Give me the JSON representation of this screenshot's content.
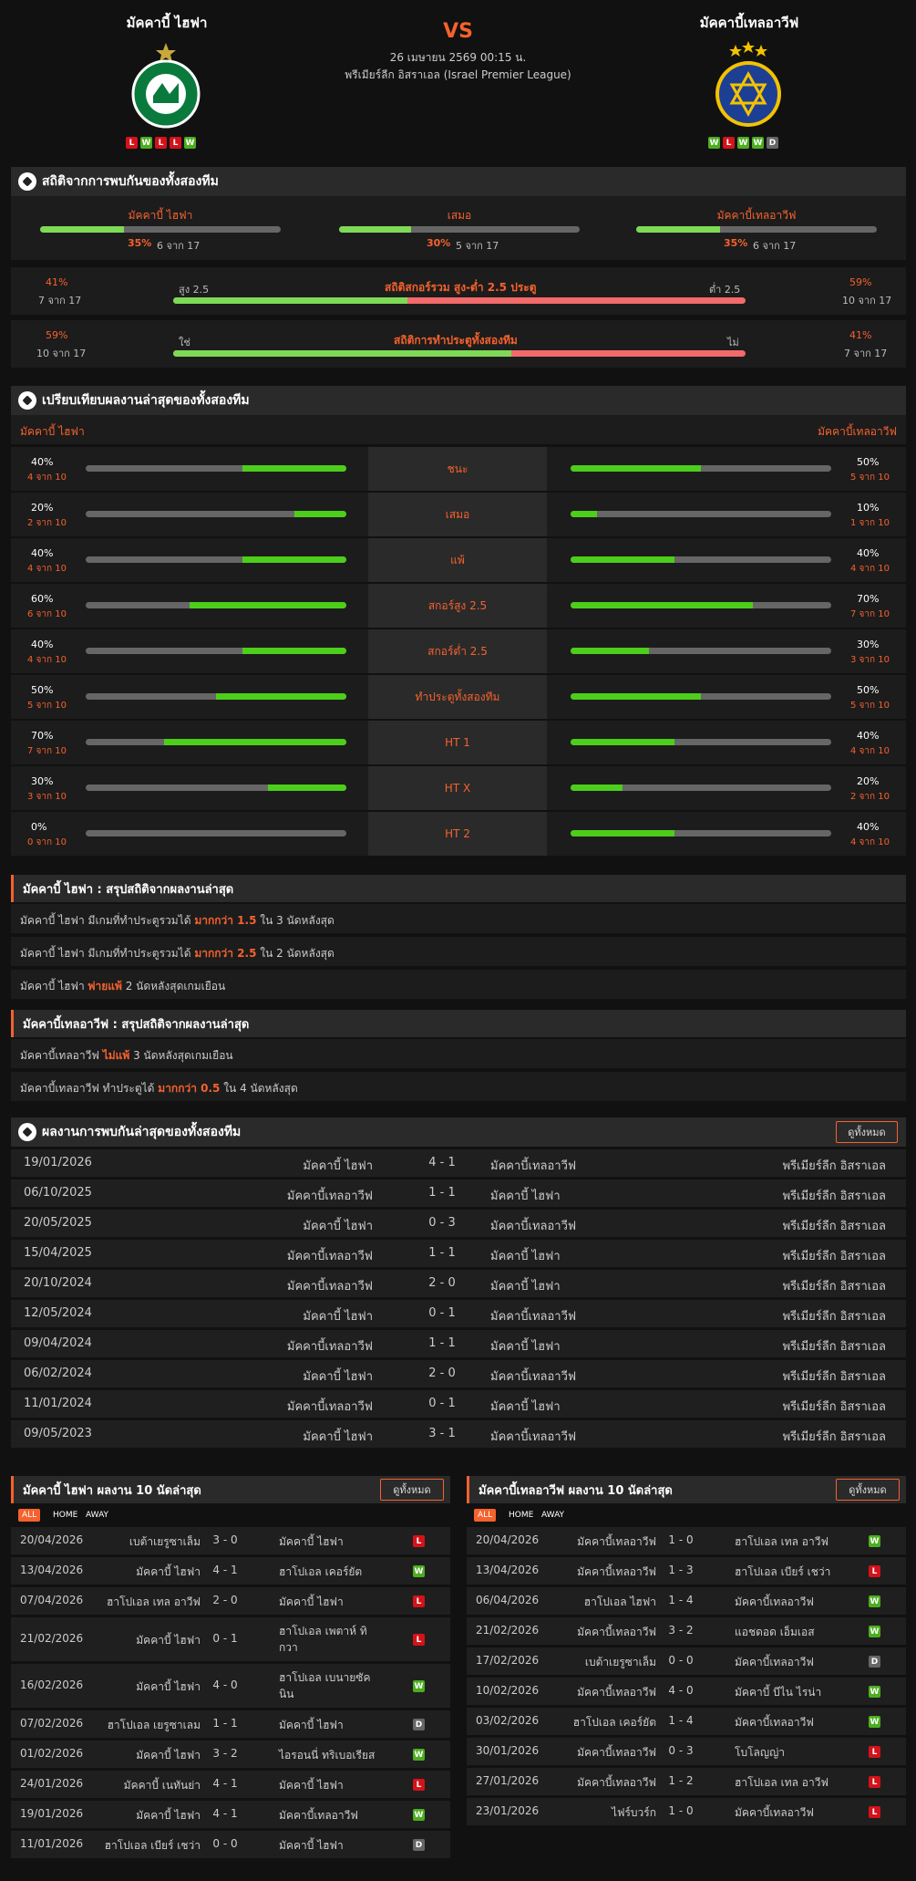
{
  "header": {
    "home": {
      "name": "มัคคาบี้ ไฮฟา",
      "form": [
        "L",
        "W",
        "L",
        "L",
        "W"
      ]
    },
    "away": {
      "name": "มัคคาบี้เทลอาวีฟ",
      "form": [
        "W",
        "L",
        "W",
        "W",
        "D"
      ]
    },
    "vs": "VS",
    "date": "26 เมษายน 2569 00:15 น.",
    "league": "พรีเมียร์ลีก อิสราเอล (Israel Premier League)",
    "home_logo_text": "MACCABI HAIFA",
    "away_logo_text": "MACCABI TEL AVIV F.C."
  },
  "h2h_stats": {
    "title": "สถิติจากการพบกันของทั้งสองทีม",
    "items": [
      {
        "label": "มัคคาบี้ ไฮฟา",
        "pct": "35%",
        "count": "6 จาก 17",
        "fill": 0.35
      },
      {
        "label": "เสมอ",
        "pct": "30%",
        "count": "5 จาก 17",
        "fill": 0.3
      },
      {
        "label": "มัคคาบี้เทลอาวีฟ",
        "pct": "35%",
        "count": "6 จาก 17",
        "fill": 0.35
      }
    ],
    "ou": {
      "left_pct": "41%",
      "left_count": "7 จาก 17",
      "over": "สูง 2.5",
      "title": "สถิติสกอร์รวม สูง-ต่ำ 2.5 ประตู",
      "under": "ต่ำ 2.5",
      "right_pct": "59%",
      "right_count": "10 จาก 17",
      "fill": 0.41
    },
    "btts": {
      "left_pct": "59%",
      "left_count": "10 จาก 17",
      "yes": "ใช่",
      "title": "สถิติการทำประตูทั้งสองทีม",
      "no": "ไม่",
      "right_pct": "41%",
      "right_count": "7 จาก 17",
      "fill": 0.59
    }
  },
  "compare": {
    "title": "เปรียบเทียบผลงานล่าสุดของทั้งสองทีม",
    "home": "มัคคาบี้ ไฮฟา",
    "away": "มัคคาบี้เทลอาวีฟ",
    "rows": [
      {
        "label": "ชนะ",
        "hp": "40%",
        "hc": "4 จาก 10",
        "hf": 0.4,
        "ap": "50%",
        "ac": "5 จาก 10",
        "af": 0.5
      },
      {
        "label": "เสมอ",
        "hp": "20%",
        "hc": "2 จาก 10",
        "hf": 0.2,
        "ap": "10%",
        "ac": "1 จาก 10",
        "af": 0.1
      },
      {
        "label": "แพ้",
        "hp": "40%",
        "hc": "4 จาก 10",
        "hf": 0.4,
        "ap": "40%",
        "ac": "4 จาก 10",
        "af": 0.4
      },
      {
        "label": "สกอร์สูง 2.5",
        "hp": "60%",
        "hc": "6 จาก 10",
        "hf": 0.6,
        "ap": "70%",
        "ac": "7 จาก 10",
        "af": 0.7
      },
      {
        "label": "สกอร์ต่ำ 2.5",
        "hp": "40%",
        "hc": "4 จาก 10",
        "hf": 0.4,
        "ap": "30%",
        "ac": "3 จาก 10",
        "af": 0.3
      },
      {
        "label": "ทำประตูทั้งสองทีม",
        "hp": "50%",
        "hc": "5 จาก 10",
        "hf": 0.5,
        "ap": "50%",
        "ac": "5 จาก 10",
        "af": 0.5
      },
      {
        "label": "HT 1",
        "hp": "70%",
        "hc": "7 จาก 10",
        "hf": 0.7,
        "ap": "40%",
        "ac": "4 จาก 10",
        "af": 0.4
      },
      {
        "label": "HT X",
        "hp": "30%",
        "hc": "3 จาก 10",
        "hf": 0.3,
        "ap": "20%",
        "ac": "2 จาก 10",
        "af": 0.2
      },
      {
        "label": "HT 2",
        "hp": "0%",
        "hc": "0 จาก 10",
        "hf": 0.0,
        "ap": "40%",
        "ac": "4 จาก 10",
        "af": 0.4
      }
    ]
  },
  "summary_home": {
    "title": "มัคคาบี้ ไฮฟา : สรุปสถิติจากผลงานล่าสุด",
    "lines": [
      {
        "a": "มัคคาบี้ ไฮฟา  มีเกมที่ทำประตูรวมได้",
        "b": "มากกว่า  1.5",
        "c": "ใน 3 นัดหลังสุด"
      },
      {
        "a": "มัคคาบี้ ไฮฟา  มีเกมที่ทำประตูรวมได้",
        "b": "มากกว่า  2.5",
        "c": "ใน 2 นัดหลังสุด"
      },
      {
        "a": "มัคคาบี้ ไฮฟา",
        "b": "พ่ายแพ้",
        "c": "2  นัดหลังสุดเกมเยือน"
      }
    ]
  },
  "summary_away": {
    "title": "มัคคาบี้เทลอาวีฟ : สรุปสถิติจากผลงานล่าสุด",
    "lines": [
      {
        "a": "มัคคาบี้เทลอาวีฟ",
        "b": "ไม่แพ้",
        "c": "3  นัดหลังสุดเกมเยือน"
      },
      {
        "a": "มัคคาบี้เทลอาวีฟ  ทำประตูได้",
        "b": "มากกว่า  0.5",
        "c": "ใน 4 นัดหลังสุด"
      }
    ]
  },
  "h2h_results": {
    "title": "ผลงานการพบกันล่าสุดของทั้งสองทีม",
    "button": "ดูทั้งหมด",
    "rows": [
      {
        "date": "19/01/2026",
        "home": "มัคคาบี้ ไฮฟา",
        "score": "4 - 1",
        "away": "มัคคาบี้เทลอาวีฟ",
        "league": "พรีเมียร์ลีก อิสราเอล"
      },
      {
        "date": "06/10/2025",
        "home": "มัคคาบี้เทลอาวีฟ",
        "score": "1 - 1",
        "away": "มัคคาบี้ ไฮฟา",
        "league": "พรีเมียร์ลีก อิสราเอล"
      },
      {
        "date": "20/05/2025",
        "home": "มัคคาบี้ ไฮฟา",
        "score": "0 - 3",
        "away": "มัคคาบี้เทลอาวีฟ",
        "league": "พรีเมียร์ลีก อิสราเอล"
      },
      {
        "date": "15/04/2025",
        "home": "มัคคาบี้เทลอาวีฟ",
        "score": "1 - 1",
        "away": "มัคคาบี้ ไฮฟา",
        "league": "พรีเมียร์ลีก อิสราเอล"
      },
      {
        "date": "20/10/2024",
        "home": "มัคคาบี้เทลอาวีฟ",
        "score": "2 - 0",
        "away": "มัคคาบี้ ไฮฟา",
        "league": "พรีเมียร์ลีก อิสราเอล"
      },
      {
        "date": "12/05/2024",
        "home": "มัคคาบี้ ไฮฟา",
        "score": "0 - 1",
        "away": "มัคคาบี้เทลอาวีฟ",
        "league": "พรีเมียร์ลีก อิสราเอล"
      },
      {
        "date": "09/04/2024",
        "home": "มัคคาบี้เทลอาวีฟ",
        "score": "1 - 1",
        "away": "มัคคาบี้ ไฮฟา",
        "league": "พรีเมียร์ลีก อิสราเอล"
      },
      {
        "date": "06/02/2024",
        "home": "มัคคาบี้ ไฮฟา",
        "score": "2 - 0",
        "away": "มัคคาบี้เทลอาวีฟ",
        "league": "พรีเมียร์ลีก อิสราเอล"
      },
      {
        "date": "11/01/2024",
        "home": "มัคคาบี้เทลอาวีฟ",
        "score": "0 - 1",
        "away": "มัคคาบี้ ไฮฟา",
        "league": "พรีเมียร์ลีก อิสราเอล"
      },
      {
        "date": "09/05/2023",
        "home": "มัคคาบี้ ไฮฟา",
        "score": "3 - 1",
        "away": "มัคคาบี้เทลอาวีฟ",
        "league": "พรีเมียร์ลีก อิสราเอล"
      }
    ]
  },
  "last10_home": {
    "title": "มัคคาบี้ ไฮฟา ผลงาน 10 นัดล่าสุด",
    "button": "ดูทั้งหมด",
    "tabs": [
      "ALL",
      "HOME",
      "AWAY"
    ],
    "rows": [
      {
        "date": "20/04/2026",
        "home": "เบต้าเยรูซาเล็ม",
        "score": "3 - 0",
        "away": "มัคคาบี้ ไฮฟา",
        "r": "L"
      },
      {
        "date": "13/04/2026",
        "home": "มัคคาบี้ ไฮฟา",
        "score": "4 - 1",
        "away": "ฮาโปเอล เคอร์ยัต",
        "r": "W"
      },
      {
        "date": "07/04/2026",
        "home": "ฮาโปเอล เทล อาวีฟ",
        "score": "2 - 0",
        "away": "มัคคาบี้ ไฮฟา",
        "r": "L"
      },
      {
        "date": "21/02/2026",
        "home": "มัคคาบี้ ไฮฟา",
        "score": "0 - 1",
        "away": "ฮาโปเอล เพตาห์ ทิกวา",
        "r": "L"
      },
      {
        "date": "16/02/2026",
        "home": "มัคคาบี้ ไฮฟา",
        "score": "4 - 0",
        "away": "ฮาโปเอล เบนายซัคนิน",
        "r": "W"
      },
      {
        "date": "07/02/2026",
        "home": "ฮาโปเอล เยรูซาเลม",
        "score": "1 - 1",
        "away": "มัคคาบี้ ไฮฟา",
        "r": "D"
      },
      {
        "date": "01/02/2026",
        "home": "มัคคาบี้ ไฮฟา",
        "score": "3 - 2",
        "away": "ไอรอนนี่ ทริเบอเรียส",
        "r": "W"
      },
      {
        "date": "24/01/2026",
        "home": "มัคคาบี้ เนทันย่า",
        "score": "4 - 1",
        "away": "มัคคาบี้ ไฮฟา",
        "r": "L"
      },
      {
        "date": "19/01/2026",
        "home": "มัคคาบี้ ไฮฟา",
        "score": "4 - 1",
        "away": "มัคคาบี้เทลอาวีฟ",
        "r": "W"
      },
      {
        "date": "11/01/2026",
        "home": "ฮาโปเอล เบียร์ เชว่า",
        "score": "0 - 0",
        "away": "มัคคาบี้ ไฮฟา",
        "r": "D"
      }
    ]
  },
  "last10_away": {
    "title": "มัคคาบี้เทลอาวีฟ ผลงาน 10 นัดล่าสุด",
    "button": "ดูทั้งหมด",
    "tabs": [
      "ALL",
      "HOME",
      "AWAY"
    ],
    "rows": [
      {
        "date": "20/04/2026",
        "home": "มัคคาบี้เทลอาวีฟ",
        "score": "1 - 0",
        "away": "ฮาโปเอล เทล อาวีฟ",
        "r": "W"
      },
      {
        "date": "13/04/2026",
        "home": "มัคคาบี้เทลอาวีฟ",
        "score": "1 - 3",
        "away": "ฮาโปเอล เบียร์ เชว่า",
        "r": "L"
      },
      {
        "date": "06/04/2026",
        "home": "ฮาโปเอล ไฮฟา",
        "score": "1 - 4",
        "away": "มัคคาบี้เทลอาวีฟ",
        "r": "W"
      },
      {
        "date": "21/02/2026",
        "home": "มัคคาบี้เทลอาวีฟ",
        "score": "3 - 2",
        "away": "แอชดอด เอ็มเอส",
        "r": "W"
      },
      {
        "date": "17/02/2026",
        "home": "เบต้าเยรูซาเล็ม",
        "score": "0 - 0",
        "away": "มัคคาบี้เทลอาวีฟ",
        "r": "D"
      },
      {
        "date": "10/02/2026",
        "home": "มัคคาบี้เทลอาวีฟ",
        "score": "4 - 0",
        "away": "มัคคาบี้ บีไน ไรน่า",
        "r": "W"
      },
      {
        "date": "03/02/2026",
        "home": "ฮาโปเอล เคอร์ยัต",
        "score": "1 - 4",
        "away": "มัคคาบี้เทลอาวีฟ",
        "r": "W"
      },
      {
        "date": "30/01/2026",
        "home": "มัคคาบี้เทลอาวีฟ",
        "score": "0 - 3",
        "away": "โบโลญญ่า",
        "r": "L"
      },
      {
        "date": "27/01/2026",
        "home": "มัคคาบี้เทลอาวีฟ",
        "score": "1 - 2",
        "away": "ฮาโปเอล เทล อาวีฟ",
        "r": "L"
      },
      {
        "date": "23/01/2026",
        "home": "ไฟร์บวร์ก",
        "score": "1 - 0",
        "away": "มัคคาบี้เทลอาวีฟ",
        "r": "L"
      }
    ]
  }
}
